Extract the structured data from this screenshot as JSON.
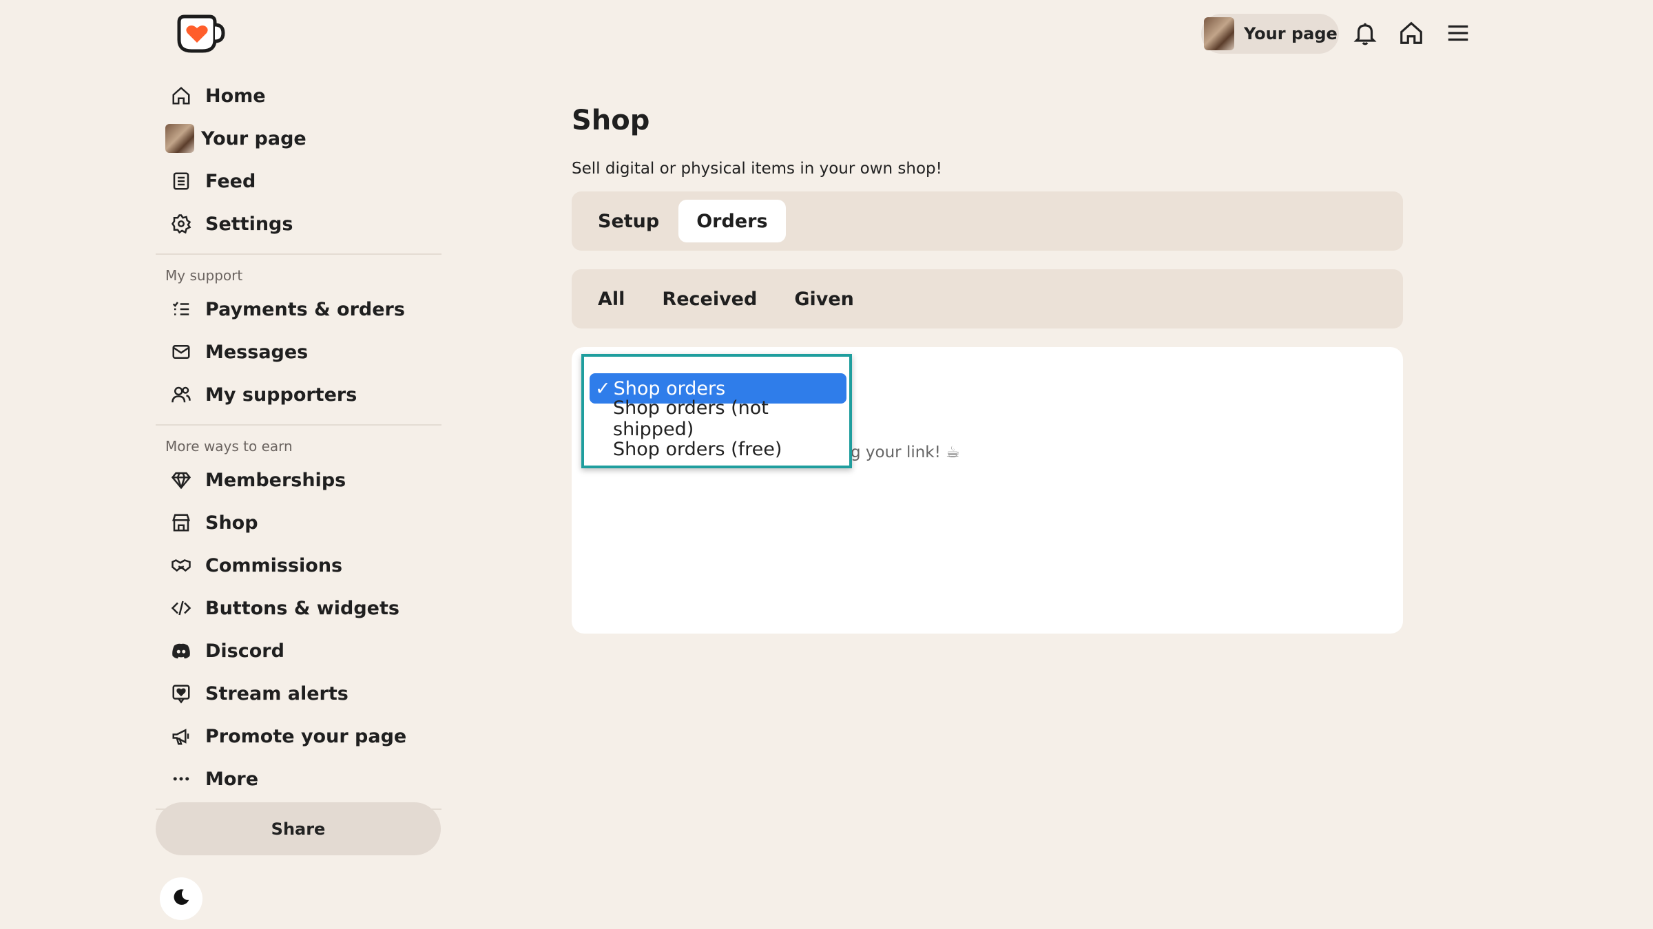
{
  "header": {
    "your_page_label": "Your page"
  },
  "sidebar": {
    "items_top": [
      {
        "label": "Home",
        "icon": "home-icon"
      },
      {
        "label": "Your page",
        "icon": "avatar"
      },
      {
        "label": "Feed",
        "icon": "feed-icon"
      },
      {
        "label": "Settings",
        "icon": "gear-icon"
      }
    ],
    "section_support": "My support",
    "items_support": [
      {
        "label": "Payments & orders",
        "icon": "list-check-icon"
      },
      {
        "label": "Messages",
        "icon": "mail-icon"
      },
      {
        "label": "My supporters",
        "icon": "users-icon"
      }
    ],
    "section_earn": "More ways to earn",
    "items_earn": [
      {
        "label": "Memberships",
        "icon": "diamond-icon"
      },
      {
        "label": "Shop",
        "icon": "store-icon"
      },
      {
        "label": "Commissions",
        "icon": "handshake-icon"
      },
      {
        "label": "Buttons & widgets",
        "icon": "code-icon"
      },
      {
        "label": "Discord",
        "icon": "discord-icon"
      },
      {
        "label": "Stream alerts",
        "icon": "stream-alert-icon"
      },
      {
        "label": "Promote your page",
        "icon": "megaphone-icon"
      },
      {
        "label": "More",
        "icon": "more-icon"
      }
    ],
    "share_label": "Share"
  },
  "main": {
    "title": "Shop",
    "subtitle": "Sell digital or physical items in your own shop!",
    "tabs": [
      {
        "label": "Setup",
        "active": false
      },
      {
        "label": "Orders",
        "active": true
      }
    ],
    "filters": [
      {
        "label": "All"
      },
      {
        "label": "Received"
      },
      {
        "label": "Given"
      }
    ],
    "empty_text_partial": "g your link! ☕"
  },
  "dropdown": {
    "selected_check": "✓",
    "options": [
      {
        "label": "Shop orders",
        "selected": true
      },
      {
        "label": "Shop orders (not shipped)",
        "selected": false
      },
      {
        "label": "Shop orders (free)",
        "selected": false
      }
    ]
  },
  "colors": {
    "background": "#f5efe8",
    "accent_logo": "#ff5e2b",
    "dropdown_border": "#1f9e9e",
    "selected_option": "#2f7dea"
  }
}
